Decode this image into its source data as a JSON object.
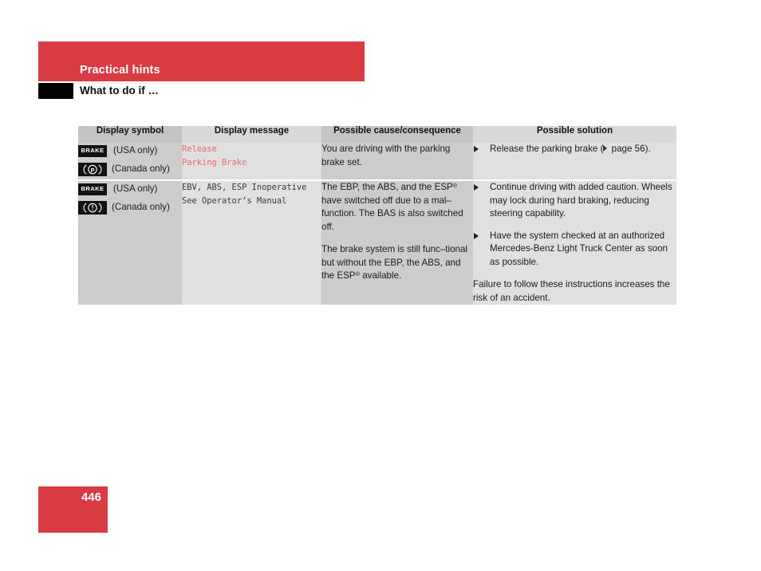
{
  "header": {
    "band_title": "Practical hints",
    "sub_title": "What to do if …",
    "band_color": "#d83b42",
    "tab_color": "#000000"
  },
  "table": {
    "columns": [
      "Display symbol",
      "Display message",
      "Possible cause/consequence",
      "Possible solution"
    ],
    "rows": [
      {
        "symbols": [
          {
            "icon": "brake-text-badge",
            "glyph": "BRAKE",
            "label": "(USA only)"
          },
          {
            "icon": "parking-brake-p-circle-badge",
            "glyph": "(P)",
            "label": "(Canada only)"
          }
        ],
        "message_lines": [
          "Release",
          "Parking Brake"
        ],
        "message_color": "#ef6a66",
        "cause_paragraphs": [
          "You are driving with the parking brake set."
        ],
        "solution_bullets": [
          "Release the parking brake (▷ page 56)."
        ],
        "solution_note": ""
      },
      {
        "symbols": [
          {
            "icon": "brake-text-badge",
            "glyph": "BRAKE",
            "label": "(USA only)"
          },
          {
            "icon": "brake-warning-exclamation-badge",
            "glyph": "(!)",
            "label": "(Canada only)"
          }
        ],
        "message_lines": [
          "EBV, ABS, ESP Inoperative",
          "See Operator’s Manual"
        ],
        "message_color": "#3a3a3a",
        "cause_paragraphs": [
          "The EBP, the ABS, and the ESP® have switched off due to a mal–function. The BAS is also switched off.",
          "The brake system is still func–tional but without the EBP, the ABS, and the ESP® available."
        ],
        "solution_bullets": [
          "Continue driving with added caution. Wheels may lock during hard braking, reducing steering capability.",
          "Have the system checked at an authorized Mercedes-Benz Light Truck Center as soon as possible."
        ],
        "solution_note": "Failure to follow these instructions increases the risk of an accident."
      }
    ]
  },
  "footer": {
    "page_number": "446",
    "box_color": "#d83b42"
  }
}
